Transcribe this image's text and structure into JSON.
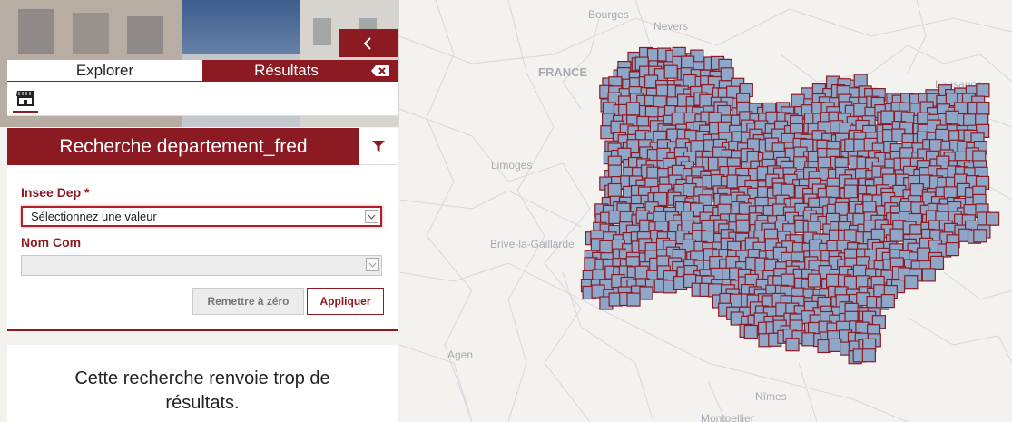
{
  "map": {
    "cities": [
      "Bourges",
      "Nevers",
      "FRANCE",
      "Lausanne",
      "Limoges",
      "Brive-la-Gaillarde",
      "Agen",
      "Nîmes",
      "Montpellier"
    ],
    "marker_fill": "#8ea7c8",
    "marker_stroke": "#8c1a23"
  },
  "panel": {
    "collapse_icon": "chevron-left-icon",
    "tabs": {
      "explore": "Explorer",
      "results": "Résultats"
    },
    "clear_icon": "backspace-icon",
    "layer_icon": "store-icon",
    "search_title": "Recherche departement_fred",
    "filter_icon": "filter-icon",
    "fields": {
      "insee_label": "Insee Dep *",
      "insee_value": "Sélectionnez une valeur",
      "nom_label": "Nom Com",
      "nom_value": ""
    },
    "buttons": {
      "reset": "Remettre à zéro",
      "apply": "Appliquer"
    },
    "message_line1": "Cette recherche renvoie trop de",
    "message_line2": "résultats.",
    "accent": "#8c1a23"
  }
}
